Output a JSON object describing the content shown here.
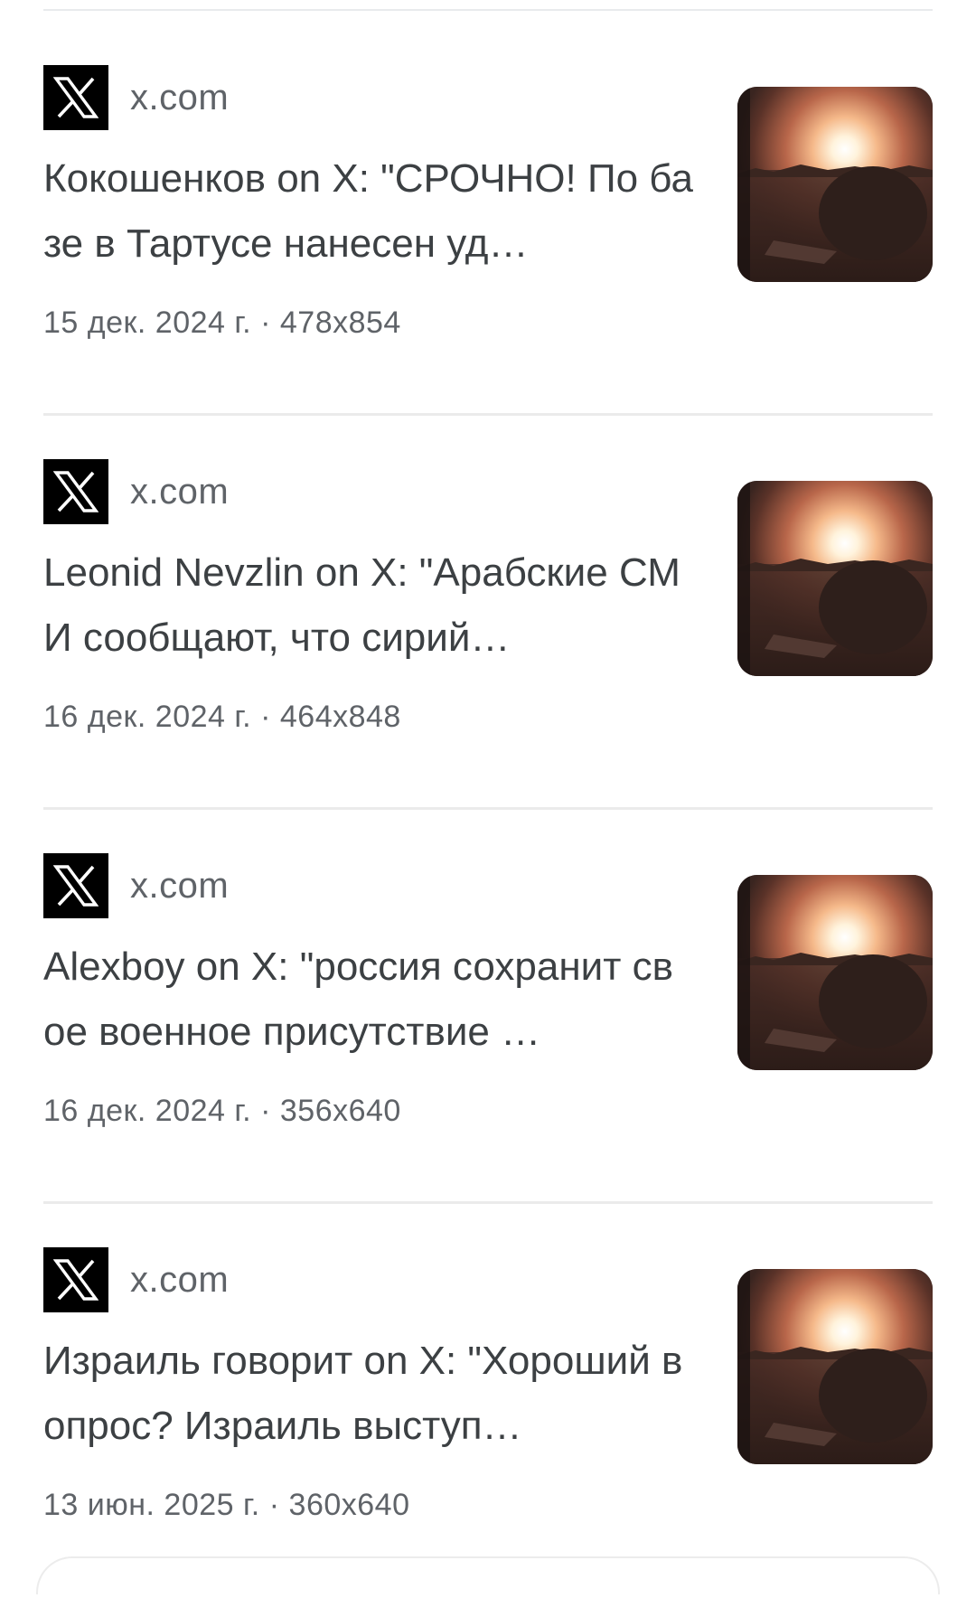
{
  "results": [
    {
      "source": "x.com",
      "title": "Кокошенков on X: \"СРОЧНО! По базе в Тартусе нанесен уд…",
      "date": "15 дек. 2024 г.",
      "separator": "·",
      "dimensions": "478x854",
      "thumbnail": "explosion-image"
    },
    {
      "source": "x.com",
      "title": "Leonid Nevzlin on X: \"Арабские СМИ сообщают, что сирий…",
      "date": "16 дек. 2024 г.",
      "separator": "·",
      "dimensions": "464x848",
      "thumbnail": "explosion-image"
    },
    {
      "source": "x.com",
      "title": "Alexboy on X: \"россия сохранит свое военное присутствие …",
      "date": "16 дек. 2024 г.",
      "separator": "·",
      "dimensions": "356x640",
      "thumbnail": "explosion-image"
    },
    {
      "source": "x.com",
      "title": "Израиль говорит on X: \"Хороший вопрос? Израиль выступ…",
      "date": "13 июн. 2025 г.",
      "separator": "·",
      "dimensions": "360x640",
      "thumbnail": "explosion-image"
    }
  ],
  "icons": {
    "source_logo": "x-logo-icon"
  },
  "colors": {
    "title_text": "#3c4043",
    "meta_text": "#5f6368",
    "divider": "#ebebeb",
    "logo_bg": "#000000"
  }
}
